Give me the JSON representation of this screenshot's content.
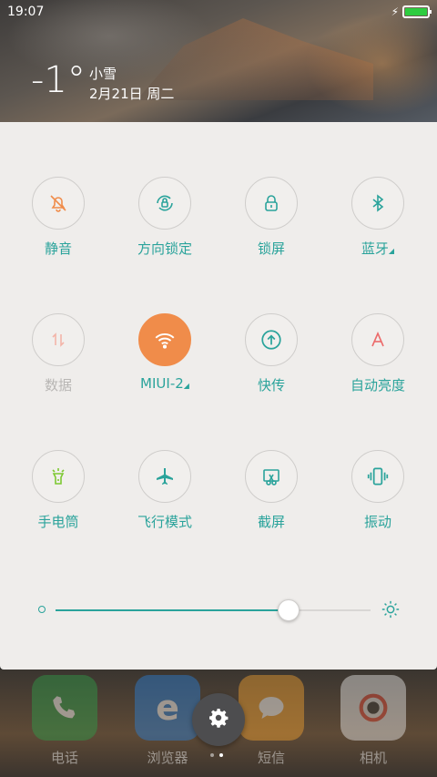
{
  "status_bar": {
    "time": "19:07",
    "battery_level": 1.0
  },
  "weather": {
    "temperature": "-1°",
    "condition": "小雪",
    "date": "2月21日 周二"
  },
  "toggles": [
    {
      "label": "静音",
      "icon": "bell-off-icon",
      "active": false,
      "dim": false,
      "has_arrow": false
    },
    {
      "label": "方向锁定",
      "icon": "rotation-lock-icon",
      "active": false,
      "dim": false,
      "has_arrow": false
    },
    {
      "label": "锁屏",
      "icon": "lock-icon",
      "active": false,
      "dim": false,
      "has_arrow": false
    },
    {
      "label": "蓝牙",
      "icon": "bluetooth-icon",
      "active": false,
      "dim": false,
      "has_arrow": true
    },
    {
      "label": "数据",
      "icon": "mobile-data-icon",
      "active": false,
      "dim": true,
      "has_arrow": false
    },
    {
      "label": "MIUI-2",
      "icon": "wifi-icon",
      "active": true,
      "dim": false,
      "has_arrow": true
    },
    {
      "label": "快传",
      "icon": "upload-icon",
      "active": false,
      "dim": false,
      "has_arrow": false
    },
    {
      "label": "自动亮度",
      "icon": "auto-brightness-icon",
      "active": false,
      "dim": false,
      "has_arrow": false
    },
    {
      "label": "手电筒",
      "icon": "flashlight-icon",
      "active": false,
      "dim": false,
      "has_arrow": false
    },
    {
      "label": "飞行模式",
      "icon": "airplane-icon",
      "active": false,
      "dim": false,
      "has_arrow": false
    },
    {
      "label": "截屏",
      "icon": "screenshot-icon",
      "active": false,
      "dim": false,
      "has_arrow": false
    },
    {
      "label": "振动",
      "icon": "vibrate-icon",
      "active": false,
      "dim": false,
      "has_arrow": false
    }
  ],
  "brightness": {
    "level": 0.74
  },
  "dock": [
    {
      "label": "电话",
      "icon": "phone-icon",
      "color": "#2e9e4a"
    },
    {
      "label": "浏览器",
      "icon": "browser-icon",
      "color": "#2b7fd6"
    },
    {
      "label": "短信",
      "icon": "message-icon",
      "color": "#f0a030"
    },
    {
      "label": "相机",
      "icon": "camera-icon",
      "color": "#e8e8e8"
    }
  ],
  "colors": {
    "accent": "#2aa39b",
    "active": "#f08c4a",
    "panel": "#efedeb"
  }
}
